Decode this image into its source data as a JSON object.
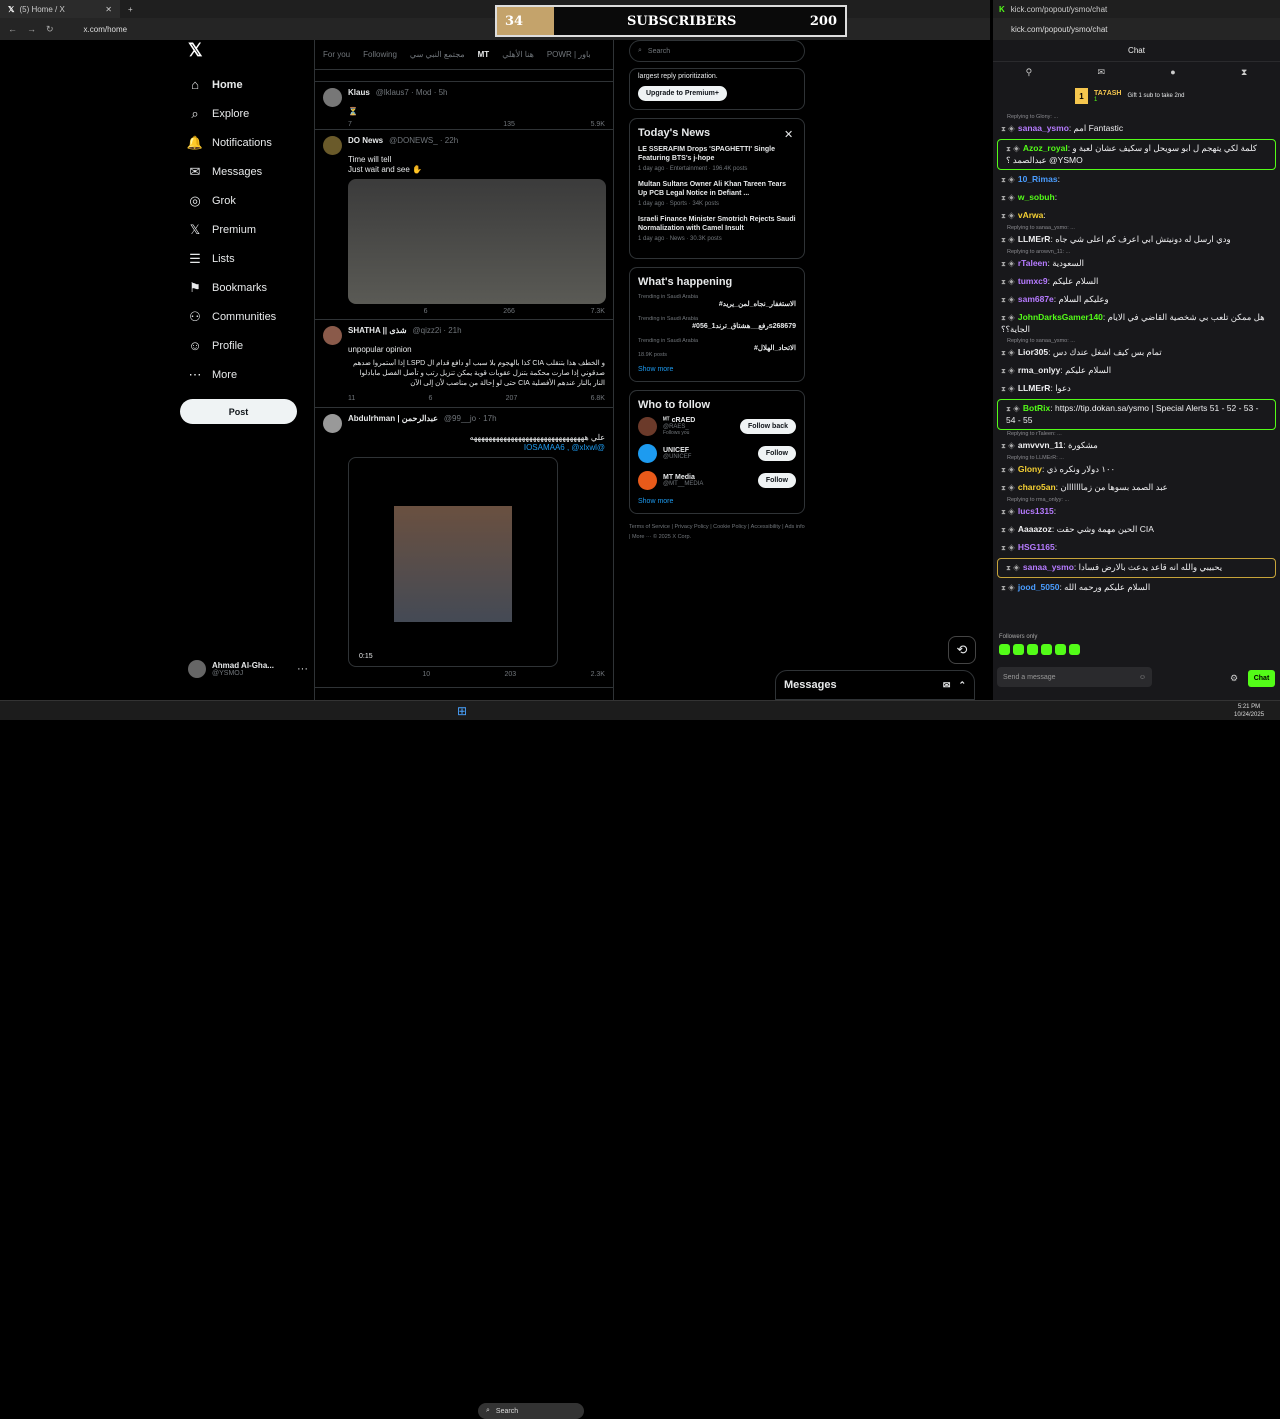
{
  "xwin": {
    "tab_title": "(5) Home / X",
    "url": "x.com/home"
  },
  "overlay": {
    "left_value": "34",
    "label": "SUBSCRIBERS",
    "right_value": "200"
  },
  "nav": [
    {
      "label": "Home",
      "icon": "home-icon"
    },
    {
      "label": "Explore",
      "icon": "search-icon"
    },
    {
      "label": "Notifications",
      "icon": "bell-icon"
    },
    {
      "label": "Messages",
      "icon": "mail-icon"
    },
    {
      "label": "Grok",
      "icon": "grok-icon"
    },
    {
      "label": "Premium",
      "icon": "x-icon"
    },
    {
      "label": "Lists",
      "icon": "list-icon"
    },
    {
      "label": "Bookmarks",
      "icon": "bookmark-icon"
    },
    {
      "label": "Communities",
      "icon": "people-icon"
    },
    {
      "label": "Profile",
      "icon": "person-icon"
    },
    {
      "label": "More",
      "icon": "more-icon"
    }
  ],
  "post_label": "Post",
  "account": {
    "name": "Ahmad Al-Gha...",
    "handle": "@YSMOJ"
  },
  "feed_tabs": [
    "For you",
    "Following",
    "مجتمع النبي سي",
    "MT",
    "هنا الأهلي",
    "POWR | باور"
  ],
  "tweets": [
    {
      "name": "Klaus",
      "handle": "@lklaus7 · Mod · 5h",
      "text": "⏳",
      "stats": [
        "7",
        "",
        "135",
        "5.9K"
      ]
    },
    {
      "name": "DO News",
      "handle": "@DONEWS_ · 22h",
      "text": "Time will tell\nJust wait and see ✋",
      "stats": [
        "",
        "6",
        "266",
        "7.3K"
      ]
    },
    {
      "name": "SHATHA || شذى",
      "handle": "@qizz2i · 21h",
      "text": "unpopular opinion",
      "text2": "و الخطف هذا بتنقلب CIA كذا بالهجوم بلا سبب أو دافع قدام ال LSPD إذا أستمروا ضدهم صدقوني إذا صارت محكمة بتنزل عقوبات قوية يمكن تنزيل رتب و تأصل الفصل مابادلوا النار بالنار عندهم الأفضلية CIA حتى لو إحالة من مناصب لأن إلى الآن",
      "stats": [
        "11",
        "6",
        "207",
        "6.8K"
      ]
    },
    {
      "name": "Abdulrhman | عبدالرحمن",
      "handle": "@99__jo · 17h",
      "text": "علي هههههههههههههههههههههههههههههههه",
      "mention": "@IOSAMAA6 , @xlxwl",
      "video_time": "0:15",
      "stats": [
        "",
        "10",
        "203",
        "2.3K"
      ]
    }
  ],
  "search_placeholder": "Search",
  "premium": {
    "partial": "largest reply prioritization.",
    "button": "Upgrade to Premium+"
  },
  "news": {
    "title": "Today's News",
    "items": [
      {
        "title": "LE SSERAFIM Drops 'SPAGHETTI' Single Featuring BTS's j-hope",
        "meta": "1 day ago · Entertainment · 196.4K posts"
      },
      {
        "title": "Multan Sultans Owner Ali Khan Tareen Tears Up PCB Legal Notice in Defiant ...",
        "meta": "1 day ago · Sports · 34K posts"
      },
      {
        "title": "Israeli Finance Minister Smotrich Rejects Saudi Normalization with Camel Insult",
        "meta": "1 day ago · News · 30.3K posts"
      }
    ]
  },
  "happening": {
    "title": "What's happening",
    "items": [
      {
        "ctx": "Trending in Saudi Arabia",
        "name": "#الاستغفار_نجاه_لمن_يريد"
      },
      {
        "ctx": "Trending in Saudi Arabia",
        "name": "#رفع__هشتاق_ترند1_056s268679"
      },
      {
        "ctx": "Trending in Saudi Arabia",
        "name": "#الاتحاد_الهلال",
        "count": "18.9K posts"
      }
    ],
    "show_more": "Show more"
  },
  "who_follow": {
    "title": "Who to follow",
    "items": [
      {
        "name": "ᴹᵀ cRAED",
        "handle": "@RAES_",
        "btn": "Follow back",
        "note": "Follows you"
      },
      {
        "name": "UNICEF",
        "handle": "@UNICEF",
        "btn": "Follow"
      },
      {
        "name": "MT Media",
        "handle": "@MT__MEDIA",
        "btn": "Follow"
      }
    ],
    "show_more": "Show more"
  },
  "footer_links": "Terms of Service | Privacy Policy | Cookie Policy | Accessibility | Ads info | More ··· © 2025 X Corp.",
  "messages_label": "Messages",
  "chat": {
    "url": "kick.com/popout/ysmo/chat",
    "header": "Chat",
    "pinned_user": "TA7ASH",
    "pinned_count": "1",
    "pinned_text": "Gift 1 sub to take 2nd",
    "messages": [
      {
        "reply": "Replying to Glony: ...",
        "user": "sanaa_ysmo",
        "color": "#b67bff",
        "text": "امم Fantastic",
        "style": ""
      },
      {
        "user": "Azoz_royal",
        "color": "#53fc18",
        "text": "كلمة لكي يتهجم ل ابو سويحل او سكيف عشان لعبة و عبدالصمد ؟ @YSMO",
        "style": "hl"
      },
      {
        "user": "10_Rimas",
        "color": "#4a9dff",
        "text": "",
        "style": ""
      },
      {
        "user": "w_sobuh",
        "color": "#53fc18",
        "text": "",
        "style": ""
      },
      {
        "user": "vArwa",
        "color": "#f5d033",
        "text": "",
        "style": ""
      },
      {
        "reply": "Replying to sanaa_ysmo: ...",
        "user": "LLMErR",
        "color": "#efeff1",
        "text": "ودي ارسل له دونيتش ابي اعرف كم اعلى شي جاه",
        "style": ""
      },
      {
        "reply": "Replying to arowvn_11: ...",
        "user": "rTaleen",
        "color": "#b67bff",
        "text": "السعودية",
        "style": ""
      },
      {
        "user": "tumxc9",
        "color": "#b67bff",
        "text": "السلام عليكم",
        "style": ""
      },
      {
        "user": "sam687e",
        "color": "#b67bff",
        "text": "وعليكم السلام",
        "style": ""
      },
      {
        "user": "JohnDarksGamer140",
        "color": "#53fc18",
        "text": "هل ممكن تلعب بي شخصية القاضي في الايام الجاية؟؟",
        "style": ""
      },
      {
        "reply": "Replying to sanaa_ysmo: ...",
        "user": "Lior305",
        "color": "#efeff1",
        "text": "تمام بس كيف اشغل عندك دس",
        "style": ""
      },
      {
        "user": "rma_onlyy",
        "color": "#efeff1",
        "text": "السلام عليكم",
        "style": ""
      },
      {
        "user": "LLMErR",
        "color": "#efeff1",
        "text": "دعوا",
        "style": ""
      },
      {
        "user": "BotRix",
        "color": "#53fc18",
        "text": "https://tip.dokan.sa/ysmo | Special Alerts 51 - 52 - 53 - 54 - 55",
        "style": "hl"
      },
      {
        "reply": "Replying to rTaleen: ...",
        "user": "amvvvn_11",
        "color": "#efeff1",
        "text": "مشكورة",
        "style": ""
      },
      {
        "reply": "Replying to LLMErR: ...",
        "user": "Glony",
        "color": "#f5d033",
        "text": "١٠٠ دولار ونكره ذي",
        "style": ""
      },
      {
        "user": "charo5an",
        "color": "#f5d033",
        "text": "عبد الصمد بسوها من زمااااااان",
        "style": ""
      },
      {
        "reply": "Replying to rma_onlyy: ...",
        "user": "lucs1315",
        "color": "#b67bff",
        "text": "",
        "style": ""
      },
      {
        "user": "Aaaazoz",
        "color": "#efeff1",
        "text": "الحين مهمة وشي حقت CIA",
        "style": ""
      },
      {
        "user": "HSG1165",
        "color": "#b67bff",
        "text": "",
        "style": ""
      },
      {
        "user": "sanaa_ysmo",
        "color": "#b67bff",
        "text": "يحبيبي والله انه قاعد يدعث بالارض فسادا",
        "style": "hl2"
      },
      {
        "user": "jood_5050",
        "color": "#4a9dff",
        "text": "السلام عليكم ورحمه الله",
        "style": ""
      }
    ],
    "followers_only": "Followers only",
    "input_placeholder": "Send a message",
    "chat_btn": "Chat"
  },
  "taskbar": {
    "search": "Search",
    "time": "5:21 PM",
    "date": "10/24/2025"
  }
}
